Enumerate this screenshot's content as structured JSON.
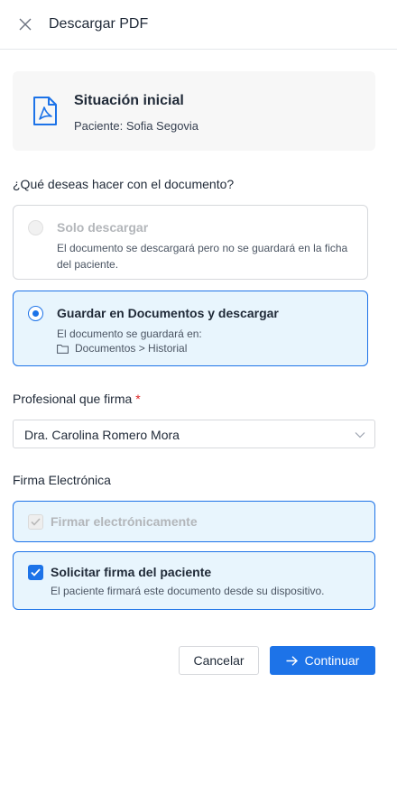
{
  "header": {
    "title": "Descargar PDF",
    "close_icon": "close-icon"
  },
  "document": {
    "icon": "pdf-file-icon",
    "title": "Situación inicial",
    "patient": "Paciente: Sofia Segovia"
  },
  "question": "¿Qué deseas hacer con el documento?",
  "options": [
    {
      "title": "Solo descargar",
      "description": "El documento se descargará pero no se guardará en la ficha del paciente.",
      "state": "disabled"
    },
    {
      "title": "Guardar en Documentos y descargar",
      "description": "El documento se guardará en:",
      "path": "Documentos > Historial",
      "state": "selected"
    }
  ],
  "professional": {
    "label": "Profesional que firma",
    "required_mark": "*",
    "value": "Dra. Carolina Romero Mora"
  },
  "signature": {
    "label": "Firma Electrónica",
    "options": [
      {
        "title": "Firmar electrónicamente",
        "checked": true,
        "disabled": true
      },
      {
        "title": "Solicitar firma del paciente",
        "description": "El paciente firmará este documento desde su dispositivo.",
        "checked": true,
        "disabled": false
      }
    ]
  },
  "actions": {
    "cancel": "Cancelar",
    "continue": "Continuar"
  },
  "colors": {
    "primary": "#1d73e8",
    "selected_bg": "#e8f5fd",
    "card_bg": "#f7f7f7",
    "required": "#dc2626"
  }
}
